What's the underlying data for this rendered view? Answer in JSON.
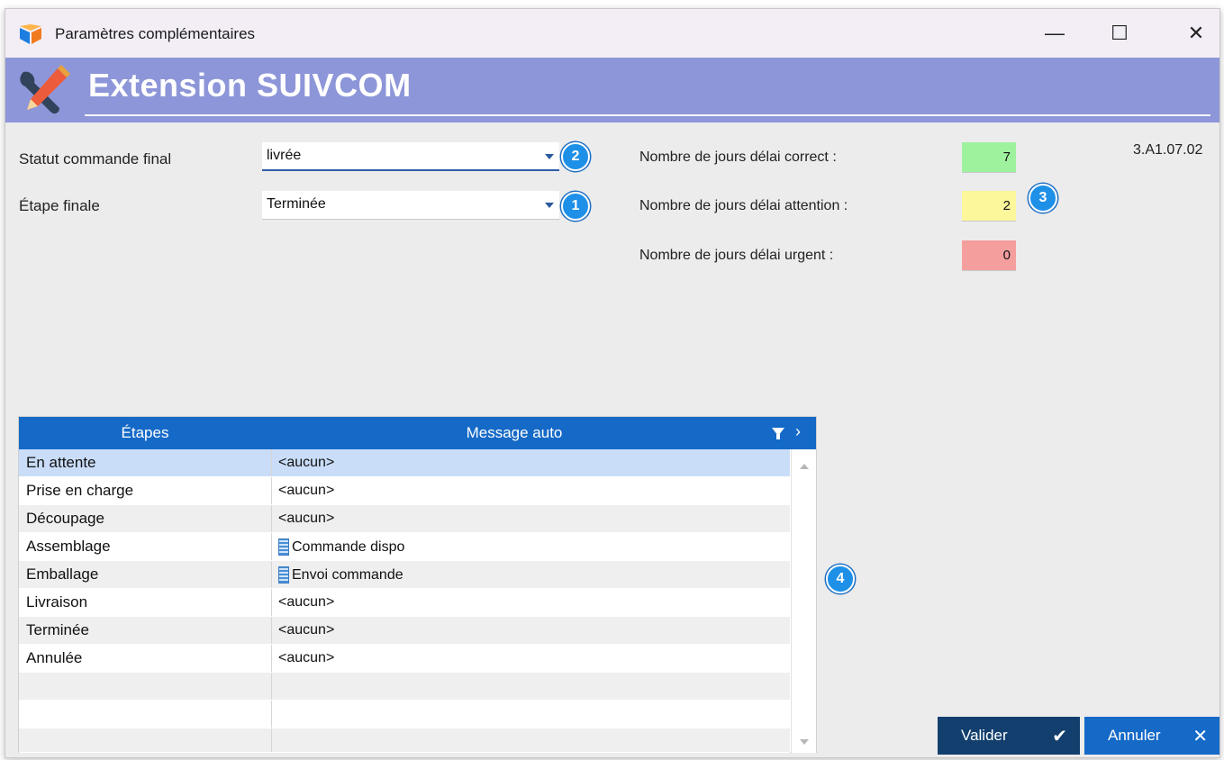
{
  "window": {
    "title": "Paramètres complémentaires",
    "controls": {
      "minimize": "—",
      "maximize": "☐",
      "close": "✕"
    }
  },
  "banner": {
    "title": "Extension SUIVCOM"
  },
  "form": {
    "statut_label": "Statut commande final",
    "statut_value": "livrée",
    "etape_label": "Étape finale",
    "etape_value": "Terminée",
    "delai_correct_label": "Nombre de jours délai correct :",
    "delai_correct_value": "7",
    "delai_correct_color": "#9ef29e",
    "delai_attention_label": "Nombre de jours délai attention :",
    "delai_attention_value": "2",
    "delai_attention_color": "#fbf79a",
    "delai_urgent_label": "Nombre de jours délai urgent :",
    "delai_urgent_value": "0",
    "delai_urgent_color": "#f59e9e",
    "version": "3.A1.07.02"
  },
  "badges": [
    "1",
    "2",
    "3",
    "4"
  ],
  "table": {
    "columns": [
      "Étapes",
      "Message auto"
    ],
    "rows": [
      {
        "etape": "En attente",
        "message": "<aucun>",
        "icon": ""
      },
      {
        "etape": "Prise en charge",
        "message": "<aucun>",
        "icon": ""
      },
      {
        "etape": "Découpage",
        "message": "<aucun>",
        "icon": ""
      },
      {
        "etape": "Assemblage",
        "message": "Commande dispo",
        "icon": "building-icon"
      },
      {
        "etape": "Emballage",
        "message": "Envoi commande",
        "icon": "building-icon"
      },
      {
        "etape": "Livraison",
        "message": "<aucun>",
        "icon": ""
      },
      {
        "etape": "Terminée",
        "message": "<aucun>",
        "icon": ""
      },
      {
        "etape": "Annulée",
        "message": "<aucun>",
        "icon": ""
      }
    ]
  },
  "buttons": {
    "ok_label": "Valider",
    "ok_glyph": "✔",
    "cancel_label": "Annuler",
    "cancel_glyph": "✕"
  },
  "colors": {
    "banner": "#8d96d8",
    "table_header": "#1569c7",
    "button_ok": "#123f6e",
    "button_cancel": "#1569c7",
    "badge": "#1e90e8",
    "selected_row": "#c9ddf8"
  }
}
